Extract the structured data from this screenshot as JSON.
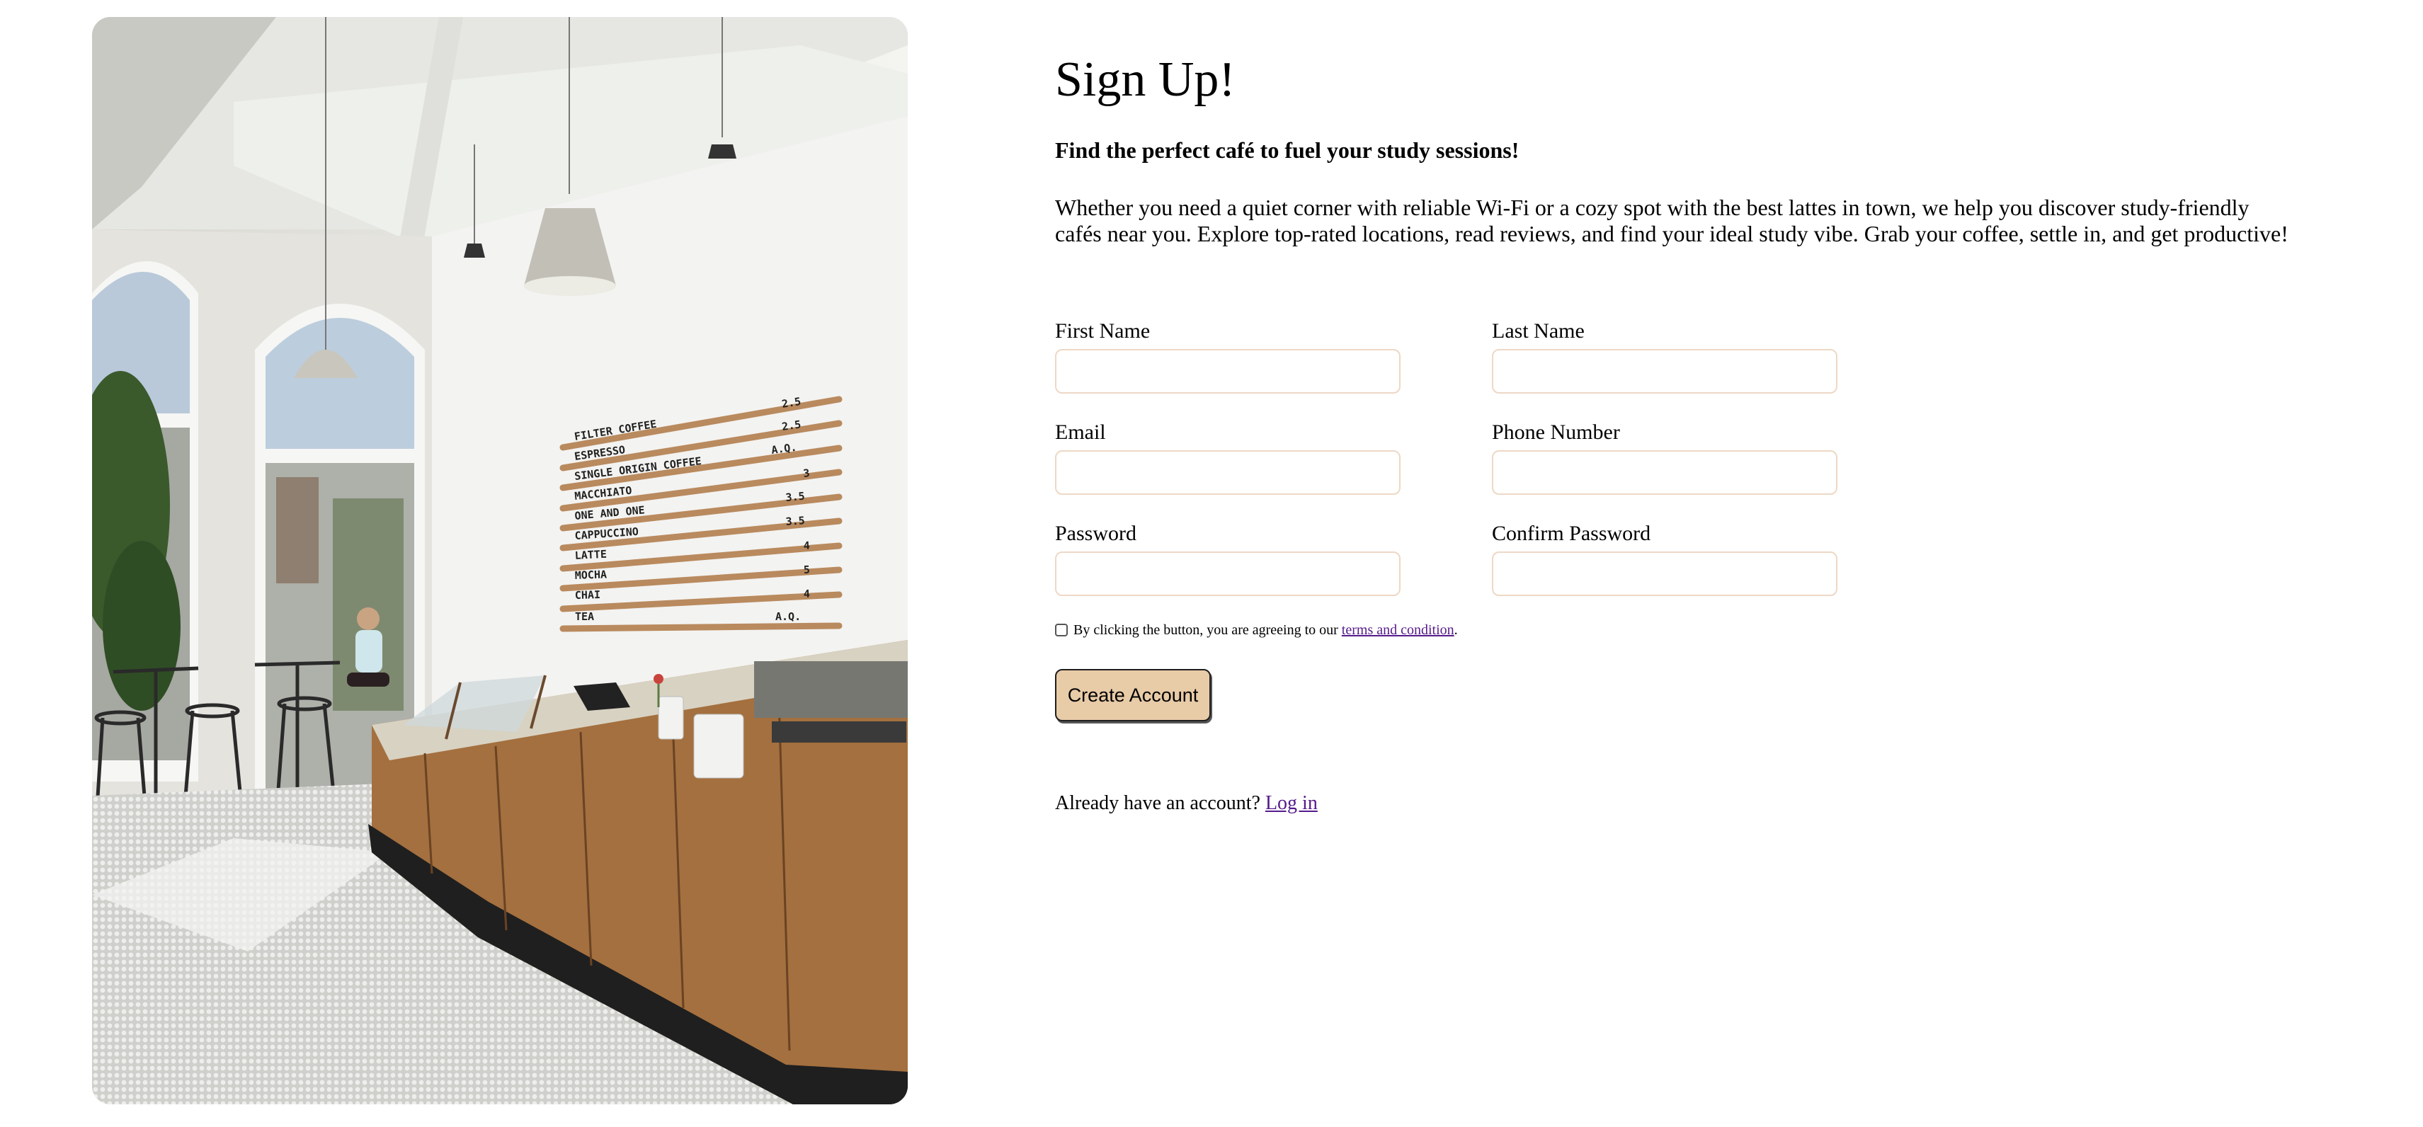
{
  "hero_image": {
    "alt": "Bright café interior with arched windows, pendant lamps, a wall menu board and a wooden counter"
  },
  "menu_board": {
    "items": [
      {
        "name": "FILTER COFFEE",
        "price": "2.5"
      },
      {
        "name": "ESPRESSO",
        "price": "2.5"
      },
      {
        "name": "SINGLE ORIGIN COFFEE",
        "price": "A.Q."
      },
      {
        "name": "MACCHIATO",
        "price": "3"
      },
      {
        "name": "ONE AND ONE",
        "price": "3.5"
      },
      {
        "name": "CAPPUCCINO",
        "price": "3.5"
      },
      {
        "name": "LATTE",
        "price": "4"
      },
      {
        "name": "MOCHA",
        "price": "5"
      },
      {
        "name": "CHAI",
        "price": "4"
      },
      {
        "name": "TEA",
        "price": "A.Q."
      }
    ]
  },
  "signup": {
    "title": "Sign Up!",
    "tagline": "Find the perfect café to fuel your study sessions!",
    "description": "Whether you need a quiet corner with reliable Wi-Fi or a cozy spot with the best lattes in town, we help you discover study-friendly cafés near you. Explore top-rated locations, read reviews, and find your ideal study vibe. Grab your coffee, settle in, and get productive!",
    "fields": {
      "first_name": {
        "label": "First Name",
        "value": "",
        "placeholder": ""
      },
      "last_name": {
        "label": "Last Name",
        "value": "",
        "placeholder": ""
      },
      "email": {
        "label": "Email",
        "value": "",
        "placeholder": ""
      },
      "phone": {
        "label": "Phone Number",
        "value": "",
        "placeholder": ""
      },
      "password": {
        "label": "Password",
        "value": "",
        "placeholder": ""
      },
      "confirm_password": {
        "label": "Confirm Password",
        "value": "",
        "placeholder": ""
      }
    },
    "terms": {
      "checked": false,
      "text": "By clicking the button, you are agreeing to our",
      "link": "terms and condition",
      "end": "."
    },
    "submit_label": "Create Account",
    "login_prompt": "Already have an account?",
    "login_link": "Log in"
  },
  "colors": {
    "button_bg": "#e8cba7",
    "input_border": "#eed8c5",
    "link": "#551a8b"
  }
}
